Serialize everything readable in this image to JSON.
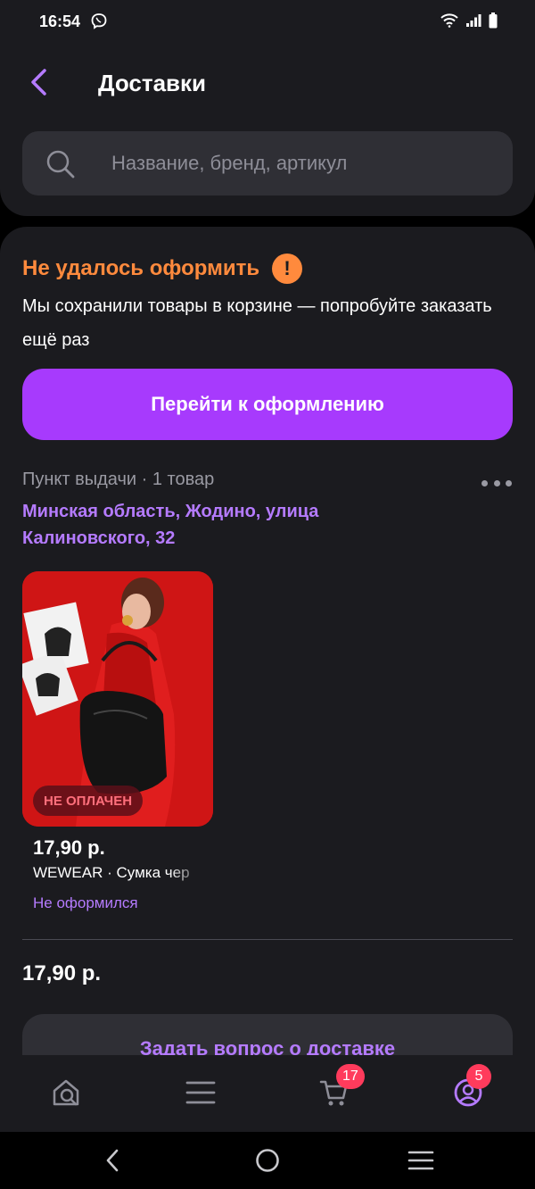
{
  "status_bar": {
    "time": "16:54"
  },
  "header": {
    "title": "Доставки"
  },
  "search": {
    "placeholder": "Название, бренд, артикул"
  },
  "error": {
    "title": "Не удалось оформить",
    "description": "Мы сохранили товары в корзине — попробуйте заказать ещё раз"
  },
  "checkout_button": "Перейти к оформлению",
  "delivery": {
    "meta": "Пункт выдачи · 1 товар",
    "address": "Минская область, Жодино, улица Калиновского, 32"
  },
  "product": {
    "badge": "НЕ ОПЛАЧЕН",
    "price": "17,90 р.",
    "name": "WEWEAR · Сумка чер",
    "status": "Не оформился"
  },
  "total": "17,90 р.",
  "ask_button": "Задать вопрос о доставке",
  "nav": {
    "cart_badge": "17",
    "profile_badge": "5"
  },
  "colors": {
    "accent": "#a73afd",
    "link": "#b57bff",
    "error": "#ff8a3d",
    "badge": "#ff3b5c"
  },
  "icons": [
    "viber-icon",
    "wifi-icon",
    "signal-icon",
    "battery-icon",
    "back-arrow-icon",
    "search-icon",
    "warning-icon",
    "more-icon",
    "home-icon",
    "catalog-icon",
    "cart-icon",
    "profile-icon"
  ]
}
